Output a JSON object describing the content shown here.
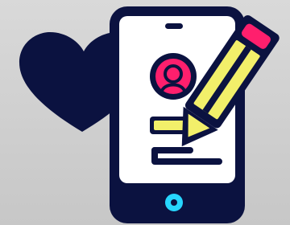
{
  "illustration": {
    "icons": {
      "heart": "heart-icon",
      "phone": "smartphone-icon",
      "profile": "user-profile-icon",
      "pencil": "pencil-icon",
      "home_button": "home-button-icon"
    },
    "colors": {
      "navy": "#0b1240",
      "white": "#ffffff",
      "pink": "#ff1f6d",
      "yellow": "#f2ef6a",
      "cyan": "#27d6ff",
      "background": "#d3d3d3"
    }
  }
}
